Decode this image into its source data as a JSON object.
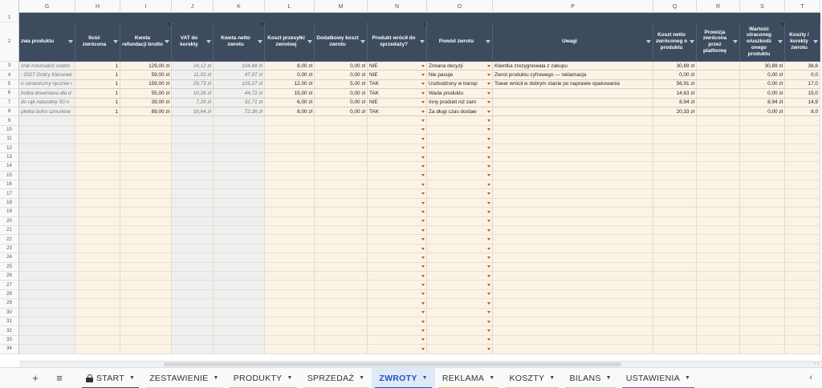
{
  "columns": [
    {
      "letter": "G",
      "header": "zwa produktu"
    },
    {
      "letter": "H",
      "header": "Ilość zwrócona"
    },
    {
      "letter": "I",
      "header": "Kwota refundacji brutto"
    },
    {
      "letter": "J",
      "header": "VAT do korekty"
    },
    {
      "letter": "K",
      "header": "Kwota netto zwrotu"
    },
    {
      "letter": "L",
      "header": "Koszt przesyłki zwrotnej"
    },
    {
      "letter": "M",
      "header": "Dodatkowy koszt zwrotu"
    },
    {
      "letter": "N",
      "header": "Produkt wrócił do sprzedaży?"
    },
    {
      "letter": "O",
      "header": "Powód zwrotu"
    },
    {
      "letter": "P",
      "header": "Uwagi"
    },
    {
      "letter": "Q",
      "header": "Koszt netto zwróconeg o produktu"
    },
    {
      "letter": "R",
      "header": "Prowizja zwrócona przez platformę"
    },
    {
      "letter": "S",
      "header": "Wartość utraconeg o/uszkodz onego produktu"
    },
    {
      "letter": "T",
      "header": "Koszty / korekty zwrotu"
    }
  ],
  "rows": [
    {
      "num": "3",
      "name": "żnik minimalist srebrn",
      "qty": "1",
      "refund": "129,00 zł",
      "vat": "24,12 zł",
      "net": "104,88 zł",
      "ship": "8,00 zł",
      "extra": "0,00 zł",
      "back": "NIE",
      "reason": "Zmiana decyzji",
      "notes": "Klientka zrezygnowała z zakupu",
      "costnet": "30,89 zł",
      "comm": "",
      "lost": "30,89 zł",
      "corr": "38,8"
    },
    {
      "num": "4",
      "name": ": 2027 Dobry Klerunek",
      "qty": "1",
      "refund": "59,00 zł",
      "vat": "11,03 zł",
      "net": "47,97 zł",
      "ship": "0,00 zł",
      "extra": "0,00 zł",
      "back": "NIE",
      "reason": "Nie pasuje",
      "notes": "Zwrot produktu cyfrowego — reklamacja",
      "costnet": "0,00 zł",
      "comm": "",
      "lost": "0,00 zł",
      "corr": "0,0"
    },
    {
      "num": "5",
      "name": "n ceramiczny ręcznie r",
      "qty": "1",
      "refund": "159,00 zł",
      "vat": "29,73 zł",
      "net": "129,27 zł",
      "ship": "12,00 zł",
      "extra": "5,00 zł",
      "back": "TAK",
      "reason": "Uszkodzony w transp",
      "notes": "Towar wrócił w dobrym stanie po naprawie opakowania",
      "costnet": "56,91 zł",
      "comm": "",
      "lost": "0,00 zł",
      "corr": "17,0"
    },
    {
      "num": "6",
      "name": "hotka drewniana dla d",
      "qty": "1",
      "refund": "55,00 zł",
      "vat": "10,28 zł",
      "net": "44,72 zł",
      "ship": "15,00 zł",
      "extra": "0,00 zł",
      "back": "TAK",
      "reason": "Wada produktu",
      "notes": "",
      "costnet": "14,63 zł",
      "comm": "",
      "lost": "0,00 zł",
      "corr": "15,0"
    },
    {
      "num": "7",
      "name": "do rąk naturalny 50 n",
      "qty": "1",
      "refund": "39,00 zł",
      "vat": "7,29 zł",
      "net": "31,71 zł",
      "ship": "6,00 zł",
      "extra": "0,00 zł",
      "back": "NIE",
      "reason": "Inny produkt niż zam",
      "notes": "",
      "costnet": "8,94 zł",
      "comm": "",
      "lost": "8,94 zł",
      "corr": "14,9"
    },
    {
      "num": "8",
      "name": "pletka boho sznurkow",
      "qty": "1",
      "refund": "89,00 zł",
      "vat": "16,64 zł",
      "net": "72,36 zł",
      "ship": "8,00 zł",
      "extra": "0,00 zł",
      "back": "TAK",
      "reason": "Za długi czas dostaw",
      "notes": "",
      "costnet": "20,33 zł",
      "comm": "",
      "lost": "0,00 zł",
      "corr": "8,0"
    }
  ],
  "empty_rows": [
    "9",
    "10",
    "11",
    "12",
    "13",
    "14",
    "15",
    "16",
    "17",
    "18",
    "19",
    "20",
    "21",
    "22",
    "23",
    "24",
    "25",
    "26",
    "27",
    "28",
    "29",
    "30",
    "31",
    "32",
    "33",
    "34"
  ],
  "header_row_numbers": [
    "1",
    "2"
  ],
  "tabs": [
    {
      "label": "START",
      "lock": true,
      "color": "#4a4a4a"
    },
    {
      "label": "ZESTAWIENIE",
      "color": "#cfd8cf"
    },
    {
      "label": "PRODUKTY",
      "color": "#f0a78a"
    },
    {
      "label": "SPRZEDAŻ",
      "color": "#f3c6a5"
    },
    {
      "label": "ZWROTY",
      "active": true,
      "color": "#1a56c9"
    },
    {
      "label": "REKLAMA",
      "color": "#f6b26b"
    },
    {
      "label": "KOSZTY",
      "color": "#f4b6a6"
    },
    {
      "label": "BILANS",
      "color": "#b6d7a8"
    },
    {
      "label": "USTAWIENIA",
      "color": "#a64d79"
    }
  ],
  "toolbar": {
    "add_icon": "+",
    "menu_icon": "≡",
    "nav_icon": "‹"
  },
  "scroll_buttons": "‹ ›"
}
